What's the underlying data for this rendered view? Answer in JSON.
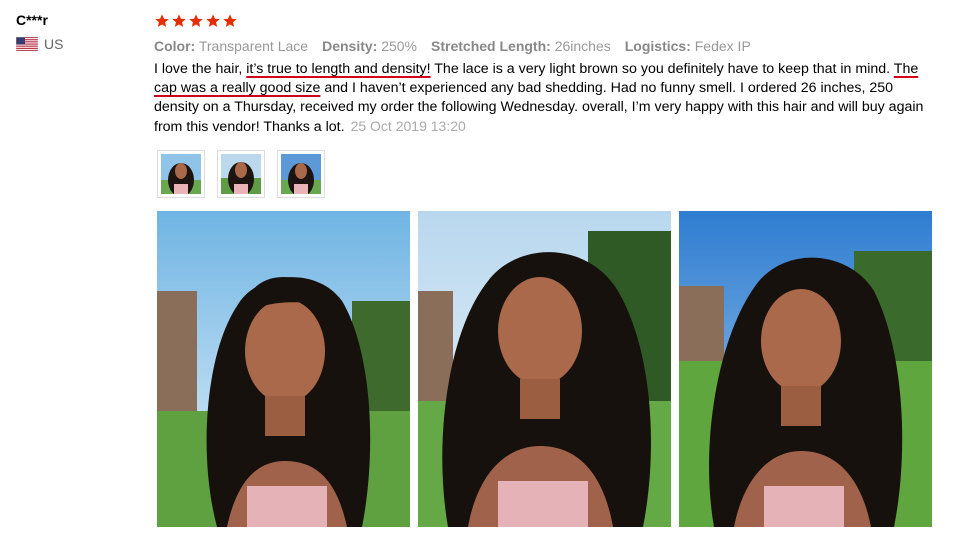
{
  "reviewer": {
    "name": "C***r",
    "country": "US",
    "flag_icon": "us-flag-icon"
  },
  "rating": {
    "stars": 5,
    "max": 5,
    "color": "#e62e04"
  },
  "attributes": [
    {
      "key": "Color:",
      "value": "Transparent Lace"
    },
    {
      "key": "Density:",
      "value": "250%"
    },
    {
      "key": "Stretched Length:",
      "value": "26inches"
    },
    {
      "key": "Logistics:",
      "value": "Fedex IP"
    }
  ],
  "review": {
    "part1": "I love the hair, ",
    "highlight1": "it’s true to length and density!",
    "part2": " The lace is a very light brown so you definitely have to keep that in mind. ",
    "highlight2": "The cap was a really good size",
    "part3": " and I haven’t experienced any bad shedding. Had no funny smell. I ordered 26 inches, 250 density on a Thursday, received my order the following Wednesday. overall, I’m very happy with this hair and will buy again from this vendor! Thanks a lot.",
    "date": "25 Oct 2019 13:20",
    "highlight_color": "#d0021b"
  },
  "thumbnails": [
    {
      "name": "review-thumbnail-1"
    },
    {
      "name": "review-thumbnail-2"
    },
    {
      "name": "review-thumbnail-3"
    }
  ],
  "photos": [
    {
      "name": "review-photo-1"
    },
    {
      "name": "review-photo-2"
    },
    {
      "name": "review-photo-3"
    }
  ]
}
